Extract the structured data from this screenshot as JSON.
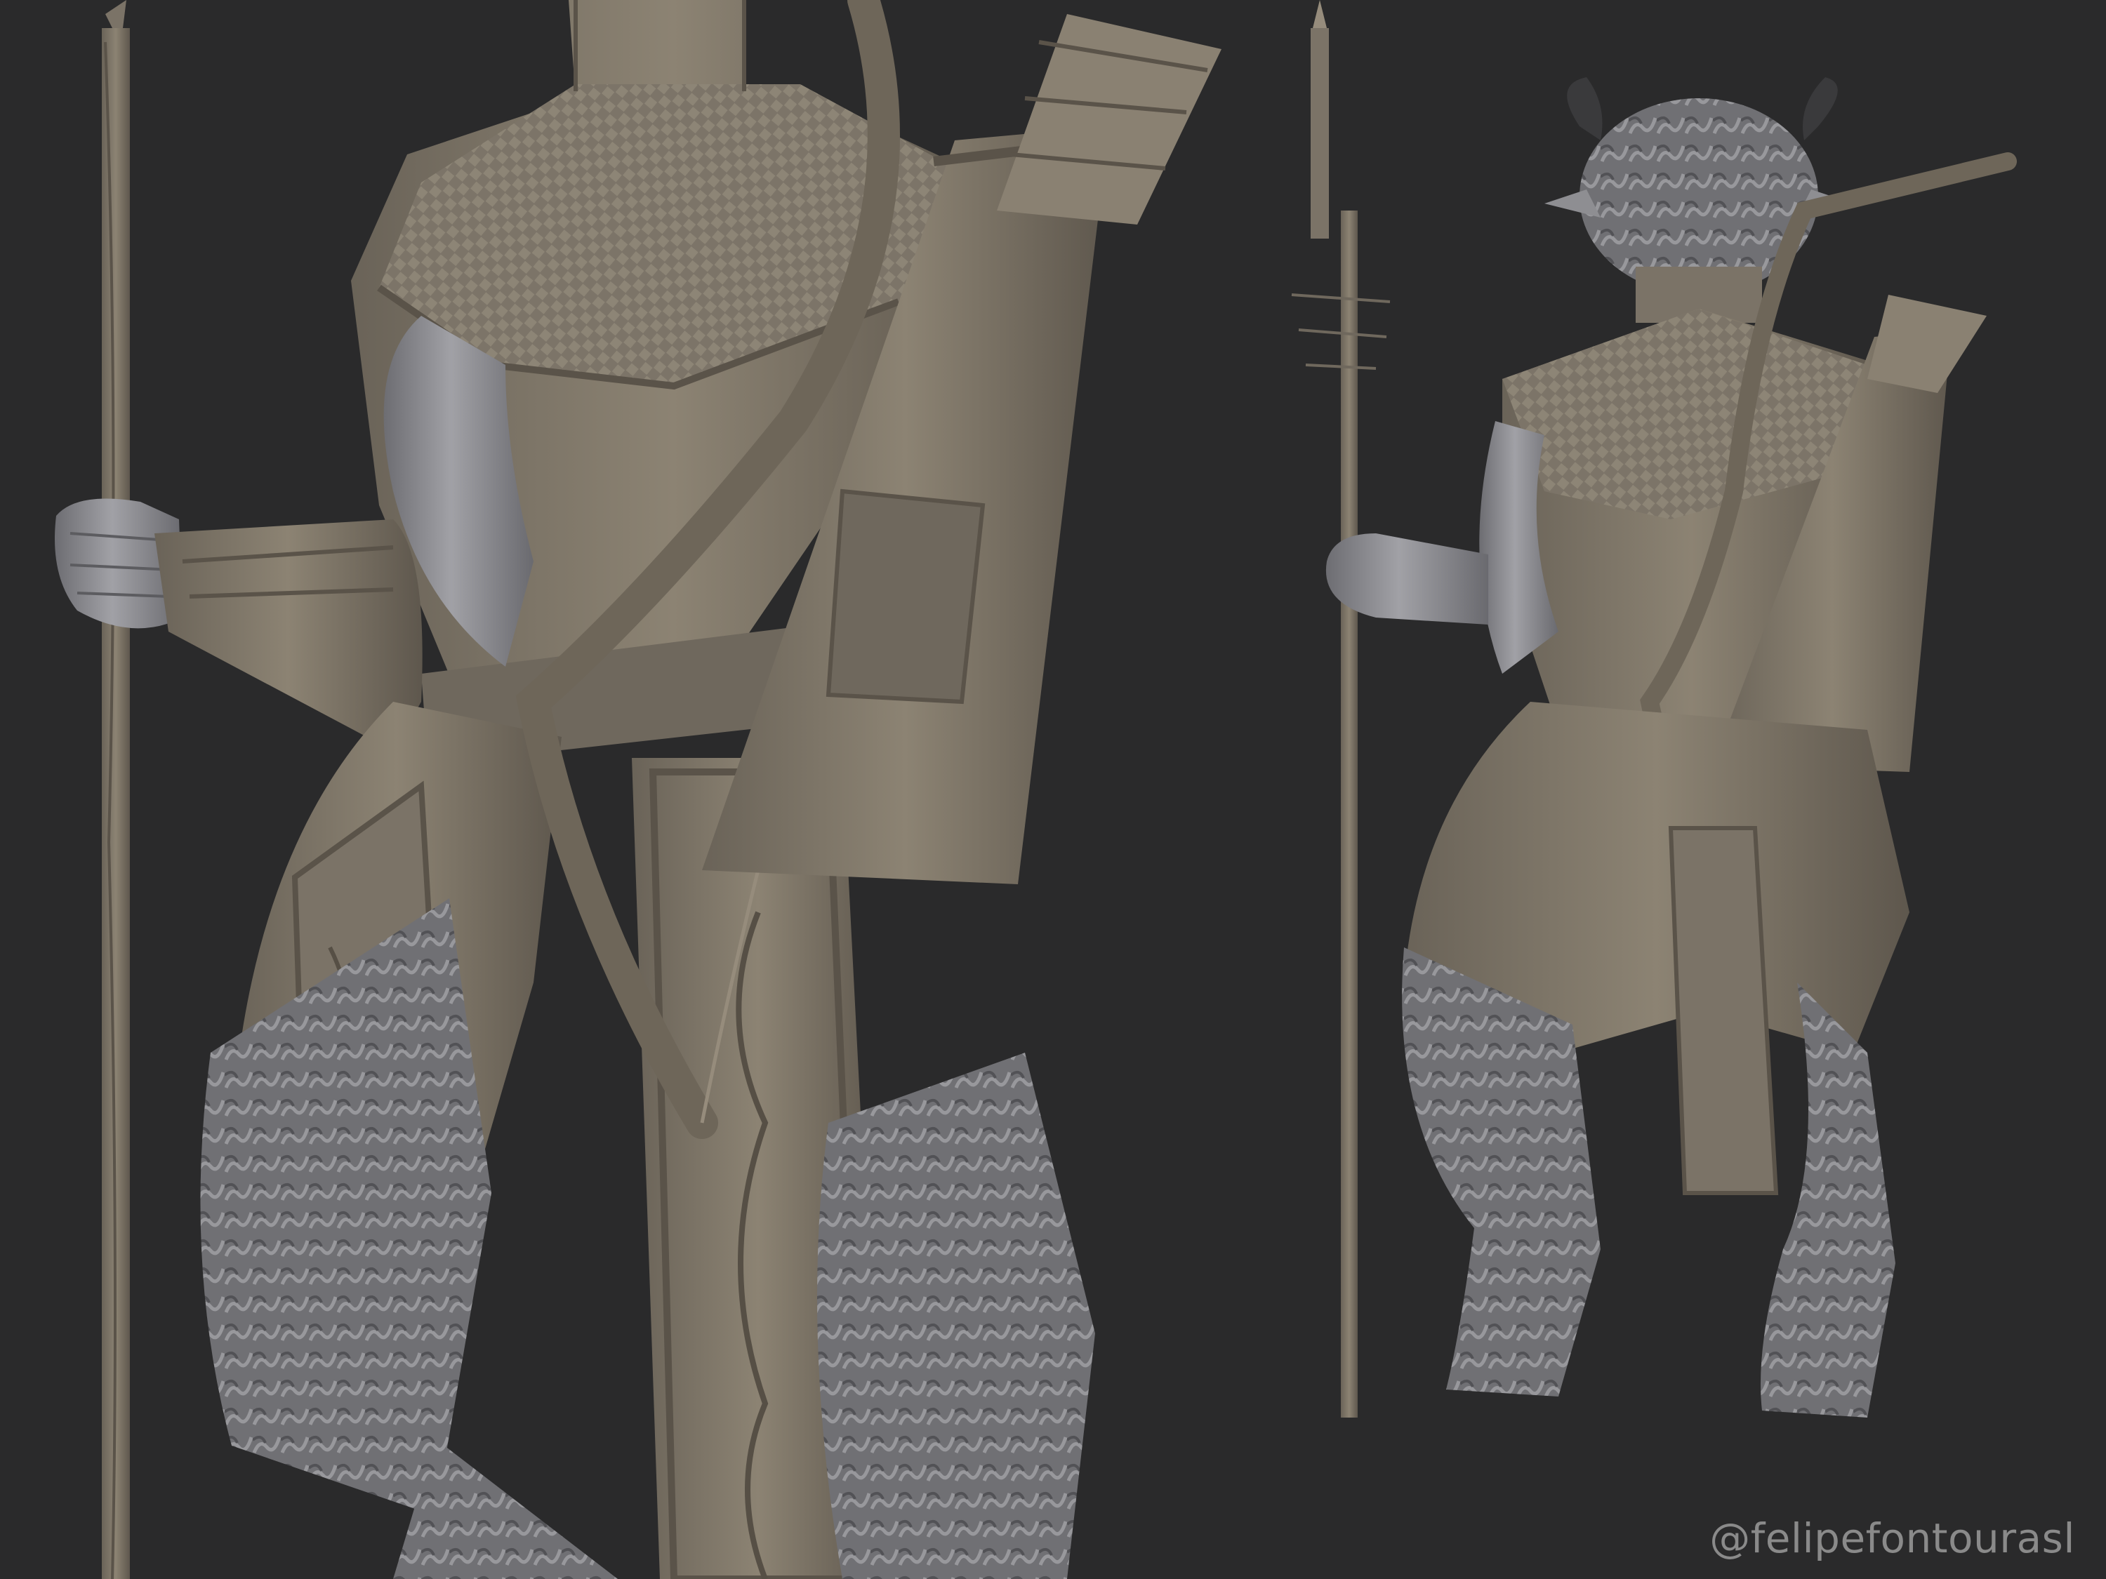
{
  "image": {
    "watermark": "@felipefontourasl",
    "colors": {
      "background": "#2a2a2b",
      "clay": "#7b7367",
      "clay_light": "#968c7c",
      "clay_dark": "#5a5349",
      "skin": "#8e8e92",
      "fur": "#77777b"
    }
  }
}
